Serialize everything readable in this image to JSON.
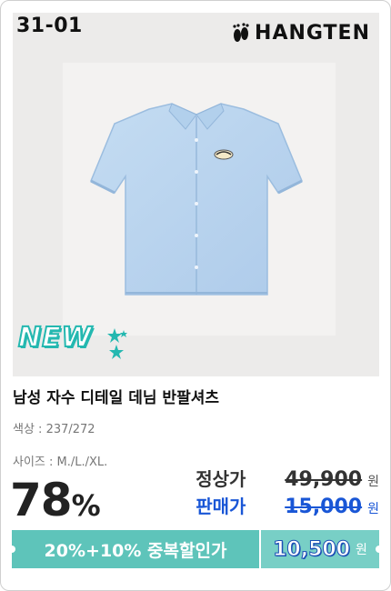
{
  "product": {
    "code": "31-01",
    "brand": "HANGTEN",
    "badge": "NEW",
    "title": "남성 자수 디테일 데님 반팔셔츠",
    "color_label": "색상 : 237/272",
    "size_label": "사이즈 : M./L./XL."
  },
  "pricing": {
    "discount_num": "78",
    "discount_pct": "%",
    "regular_label": "정상가",
    "regular_price": "49,900",
    "sale_label": "판매가",
    "sale_price": "15,000",
    "unit": "원"
  },
  "promo": {
    "text": "20%+10% 중복할인가",
    "price": "10,500",
    "unit": "원"
  },
  "colors": {
    "shirt": "#b9d6ef",
    "sale_blue": "#1956d6",
    "promo_teal": "#5ec4ba",
    "new_teal": "#24b8b0"
  },
  "icons": [
    "foot-logo-icon",
    "star-icon"
  ]
}
